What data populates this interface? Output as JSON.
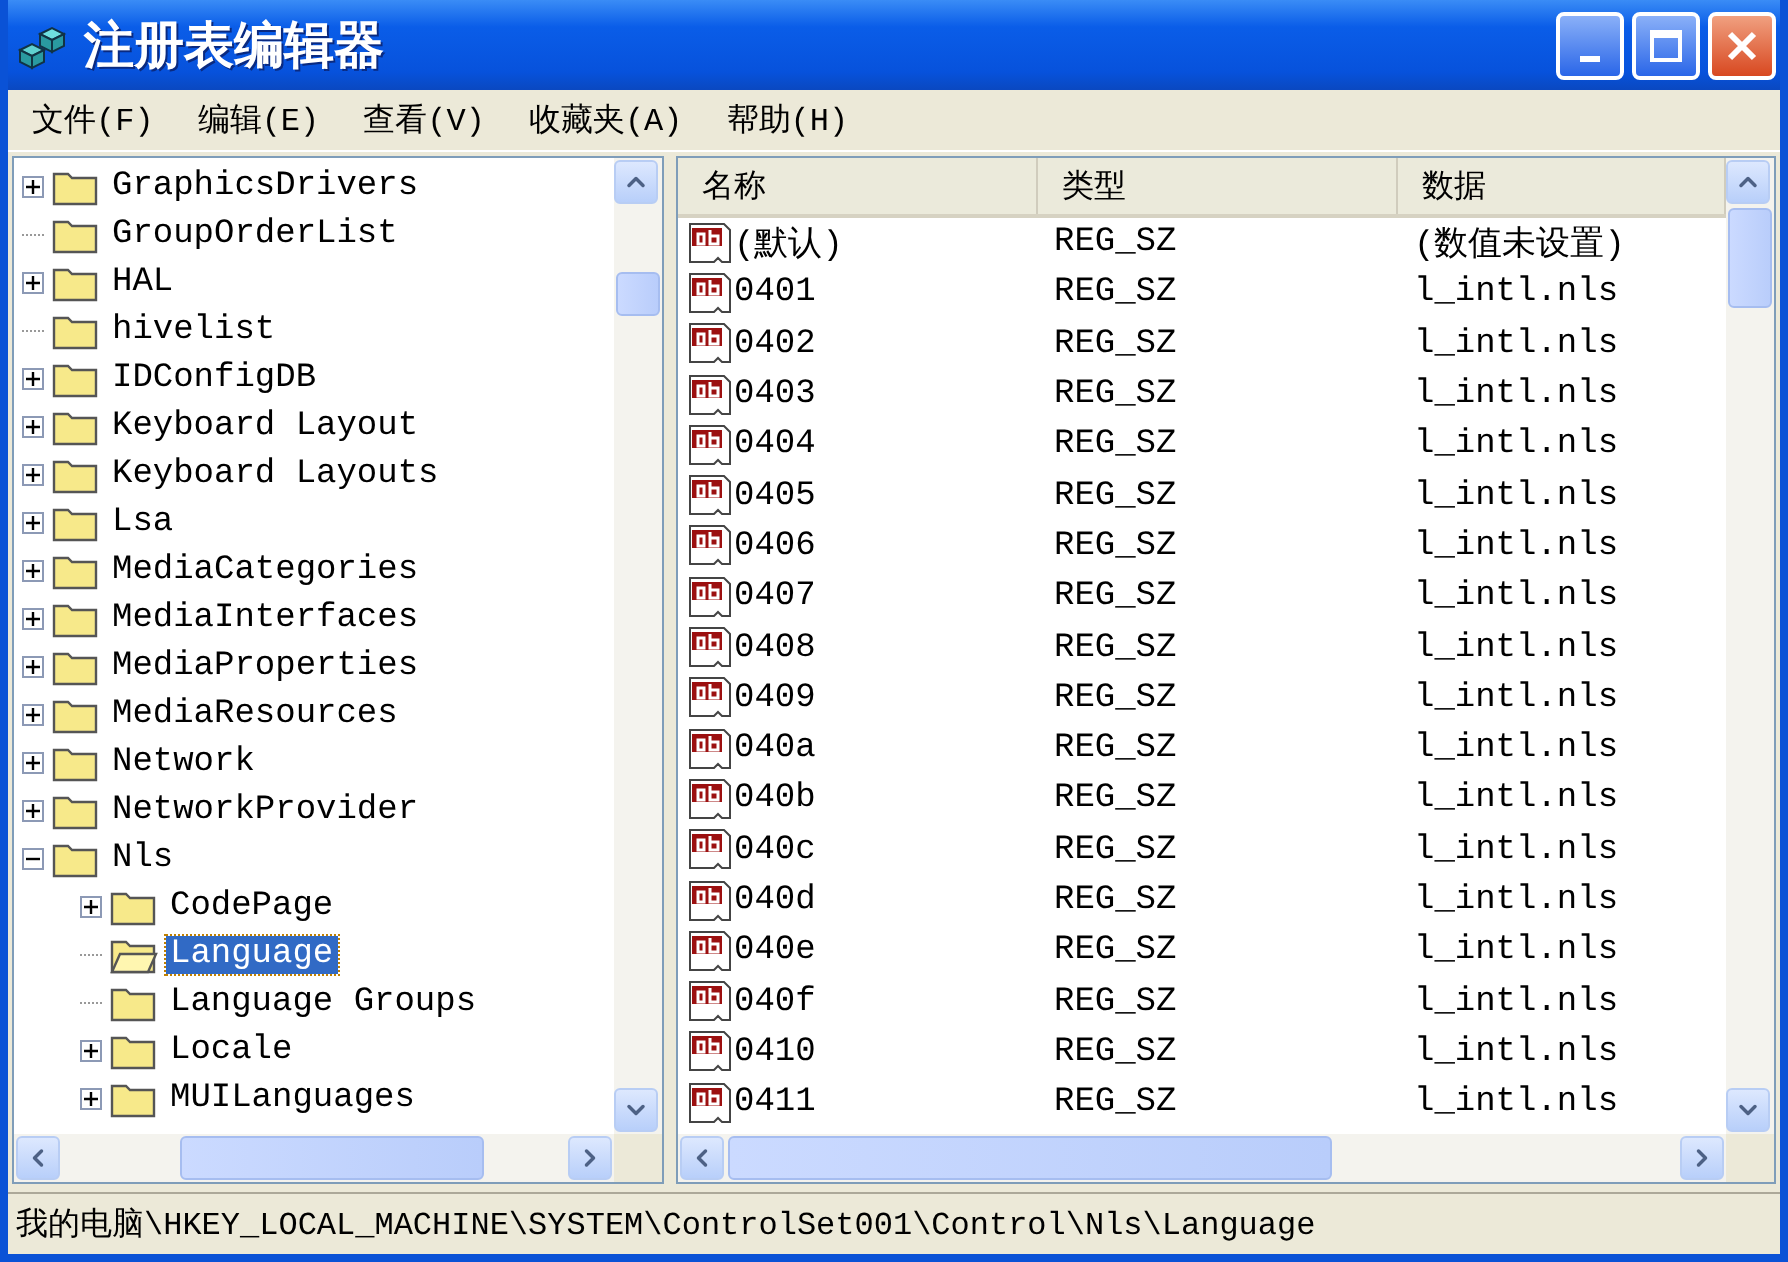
{
  "window": {
    "title": "注册表编辑器"
  },
  "menu": [
    {
      "label": "文件(F)"
    },
    {
      "label": "编辑(E)"
    },
    {
      "label": "查看(V)"
    },
    {
      "label": "收藏夹(A)"
    },
    {
      "label": "帮助(H)"
    }
  ],
  "tree": [
    {
      "label": "GraphicsDrivers",
      "expandable": true,
      "expanded": false,
      "selected": false
    },
    {
      "label": "GroupOrderList",
      "expandable": false,
      "selected": false
    },
    {
      "label": "HAL",
      "expandable": true,
      "expanded": false,
      "selected": false
    },
    {
      "label": "hivelist",
      "expandable": false,
      "selected": false
    },
    {
      "label": "IDConfigDB",
      "expandable": true,
      "expanded": false,
      "selected": false
    },
    {
      "label": "Keyboard Layout",
      "expandable": true,
      "expanded": false,
      "selected": false
    },
    {
      "label": "Keyboard Layouts",
      "expandable": true,
      "expanded": false,
      "selected": false
    },
    {
      "label": "Lsa",
      "expandable": true,
      "expanded": false,
      "selected": false
    },
    {
      "label": "MediaCategories",
      "expandable": true,
      "expanded": false,
      "selected": false
    },
    {
      "label": "MediaInterfaces",
      "expandable": true,
      "expanded": false,
      "selected": false
    },
    {
      "label": "MediaProperties",
      "expandable": true,
      "expanded": false,
      "selected": false
    },
    {
      "label": "MediaResources",
      "expandable": true,
      "expanded": false,
      "selected": false
    },
    {
      "label": "Network",
      "expandable": true,
      "expanded": false,
      "selected": false
    },
    {
      "label": "NetworkProvider",
      "expandable": true,
      "expanded": false,
      "selected": false
    },
    {
      "label": "Nls",
      "expandable": true,
      "expanded": true,
      "selected": false,
      "children": [
        {
          "label": "CodePage",
          "expandable": true,
          "expanded": false,
          "selected": false
        },
        {
          "label": "Language",
          "expandable": false,
          "selected": true
        },
        {
          "label": "Language Groups",
          "expandable": false,
          "selected": false
        },
        {
          "label": "Locale",
          "expandable": true,
          "expanded": false,
          "selected": false
        },
        {
          "label": "MUILanguages",
          "expandable": true,
          "expanded": false,
          "selected": false
        }
      ]
    }
  ],
  "table": {
    "columns": [
      "名称",
      "类型",
      "数据"
    ],
    "rows": [
      [
        "(默认)",
        "REG_SZ",
        "(数值未设置)"
      ],
      [
        "0401",
        "REG_SZ",
        "l_intl.nls"
      ],
      [
        "0402",
        "REG_SZ",
        "l_intl.nls"
      ],
      [
        "0403",
        "REG_SZ",
        "l_intl.nls"
      ],
      [
        "0404",
        "REG_SZ",
        "l_intl.nls"
      ],
      [
        "0405",
        "REG_SZ",
        "l_intl.nls"
      ],
      [
        "0406",
        "REG_SZ",
        "l_intl.nls"
      ],
      [
        "0407",
        "REG_SZ",
        "l_intl.nls"
      ],
      [
        "0408",
        "REG_SZ",
        "l_intl.nls"
      ],
      [
        "0409",
        "REG_SZ",
        "l_intl.nls"
      ],
      [
        "040a",
        "REG_SZ",
        "l_intl.nls"
      ],
      [
        "040b",
        "REG_SZ",
        "l_intl.nls"
      ],
      [
        "040c",
        "REG_SZ",
        "l_intl.nls"
      ],
      [
        "040d",
        "REG_SZ",
        "l_intl.nls"
      ],
      [
        "040e",
        "REG_SZ",
        "l_intl.nls"
      ],
      [
        "040f",
        "REG_SZ",
        "l_intl.nls"
      ],
      [
        "0410",
        "REG_SZ",
        "l_intl.nls"
      ],
      [
        "0411",
        "REG_SZ",
        "l_intl.nls"
      ]
    ]
  },
  "status_bar": "我的电脑\\HKEY_LOCAL_MACHINE\\SYSTEM\\ControlSet001\\Control\\Nls\\Language"
}
